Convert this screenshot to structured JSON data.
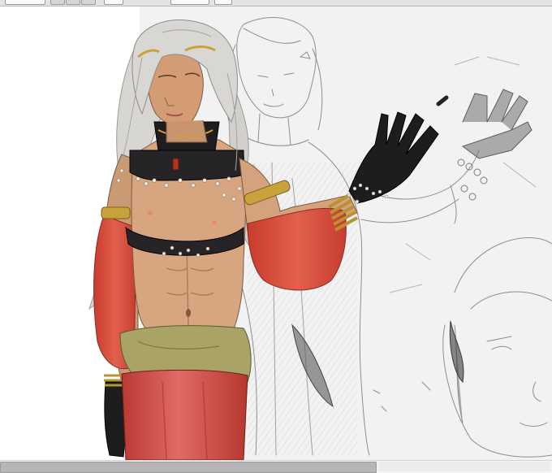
{
  "app": {
    "canvas_content": "digital-painting-with-sketch-layer",
    "scroll_position_fraction": 0.0,
    "scroll_visible_fraction": 0.68
  },
  "colors": {
    "toolbar_bg": "#e4e4e4",
    "canvas_bg": "#ffffff",
    "paper_bg": "#f3f3f3",
    "skin": "#d7a680",
    "hair": "#d6d3cf",
    "sleeve_red": "#d8493a",
    "skirt_red": "#c8453d",
    "sash_olive": "#a9a366",
    "glove_black": "#1d1d1d",
    "top_black": "#262426",
    "gold": "#c8a33c",
    "sketch_pencil": "#8b8b8b"
  },
  "icons": {
    "toolbar_buttons": [
      "toolbar-button-icon"
    ],
    "scrollbar": "horizontal-scrollbar"
  }
}
